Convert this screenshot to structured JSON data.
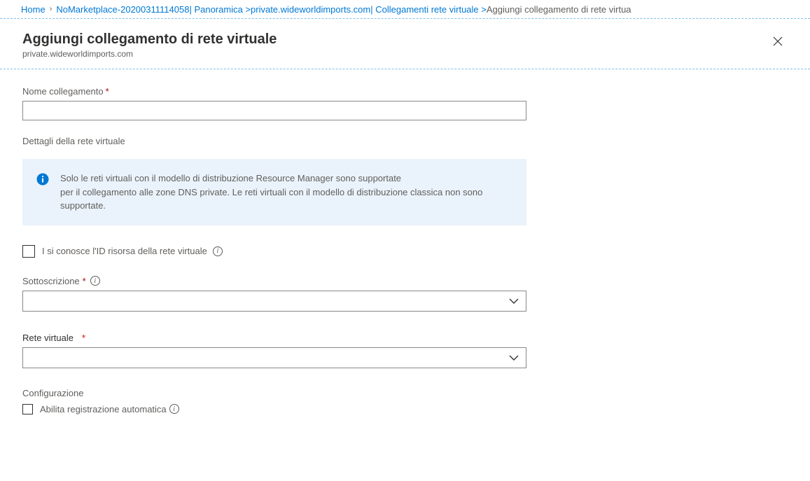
{
  "breadcrumb": {
    "home": "Home",
    "item1": "NoMarketplace-20200311114058",
    "item1_suffix": " | Panoramica >",
    "item2": "private.wideworldimports.com",
    "item2_suffix": " | Collegamenti rete virtuale >",
    "current": "Aggiungi collegamento di rete virtua"
  },
  "blade": {
    "title": "Aggiungi collegamento di rete virtuale",
    "subtitle": "private.wideworldimports.com"
  },
  "form": {
    "link_name_label": "Nome collegamento",
    "link_name_value": "",
    "vnet_details_heading": "Dettagli della rete virtuale",
    "info_line1": "Solo le reti virtuali con il modello di distribuzione Resource Manager sono supportate",
    "info_line2": "per il collegamento alle zone DNS private. Le reti virtuali con il modello di distribuzione classica non sono",
    "info_line3": "supportate.",
    "know_resource_id_label": "I si conosce l'ID risorsa della rete virtuale",
    "subscription_label": "Sottoscrizione",
    "subscription_value": "",
    "vnet_label": "Rete virtuale",
    "vnet_value": "",
    "configuration_heading": "Configurazione",
    "auto_reg_label": "Abilita registrazione automatica"
  }
}
